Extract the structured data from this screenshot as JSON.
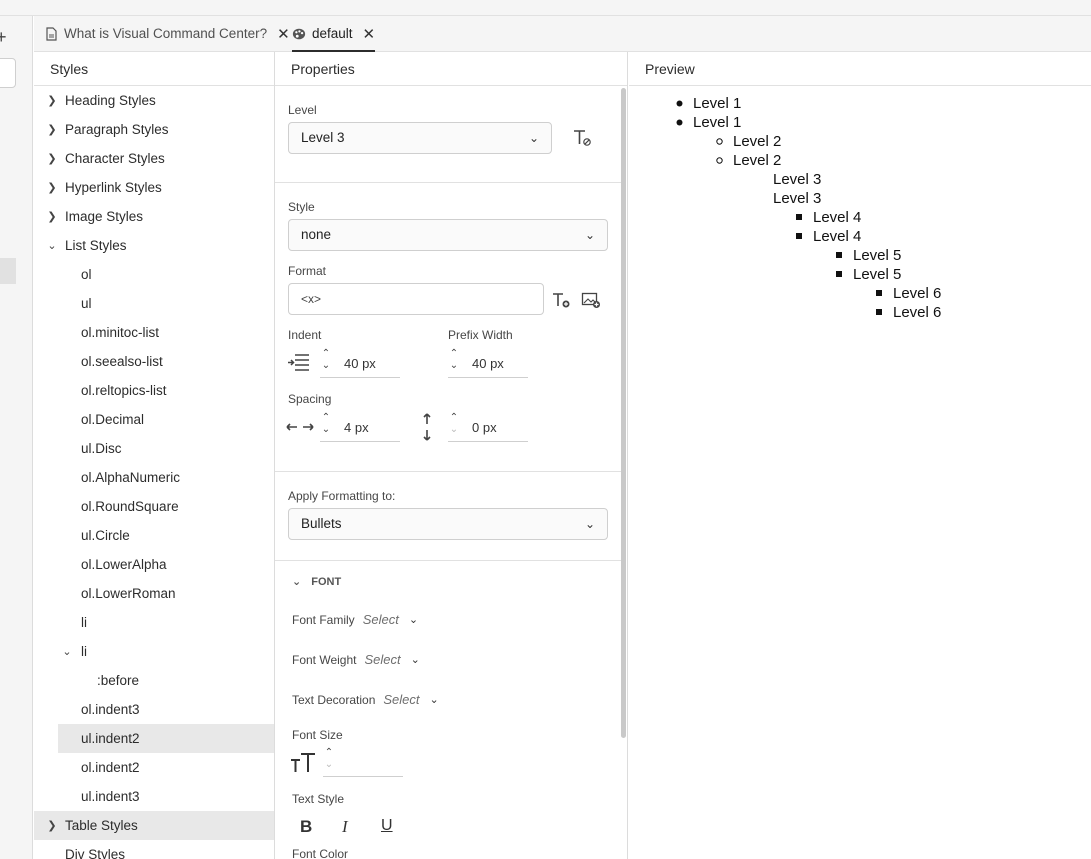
{
  "tabs": [
    {
      "label": "What is Visual Command Center?",
      "icon": "document-icon",
      "active": false
    },
    {
      "label": "default",
      "icon": "palette-icon",
      "active": true
    }
  ],
  "styles_panel": {
    "title": "Styles",
    "groups": [
      {
        "label": "Heading Styles",
        "expanded": false
      },
      {
        "label": "Paragraph Styles",
        "expanded": false
      },
      {
        "label": "Character Styles",
        "expanded": false
      },
      {
        "label": "Hyperlink Styles",
        "expanded": false
      },
      {
        "label": "Image Styles",
        "expanded": false
      },
      {
        "label": "List Styles",
        "expanded": true
      },
      {
        "label": "Table Styles",
        "expanded": false
      },
      {
        "label": "Div Styles",
        "expanded": false
      }
    ],
    "list_items": [
      "ol",
      "ul",
      "ol.minitoc-list",
      "ol.seealso-list",
      "ol.reltopics-list",
      "ol.Decimal",
      "ul.Disc",
      "ol.AlphaNumeric",
      "ol.RoundSquare",
      "ul.Circle",
      "ol.LowerAlpha",
      "ol.LowerRoman",
      "li",
      "li",
      ":before",
      "ol.indent3",
      "ul.indent2",
      "ol.indent2",
      "ul.indent3"
    ]
  },
  "properties_panel": {
    "title": "Properties",
    "level": {
      "label": "Level",
      "value": "Level 3"
    },
    "style": {
      "label": "Style",
      "value": "none"
    },
    "format": {
      "label": "Format",
      "value": "<x>"
    },
    "indent": {
      "label": "Indent",
      "value": "40 px"
    },
    "prefix_width": {
      "label": "Prefix Width",
      "value": "40 px"
    },
    "spacing": {
      "label": "Spacing",
      "horizontal": "4 px",
      "vertical": "0 px"
    },
    "apply_formatting": {
      "label": "Apply Formatting to:",
      "value": "Bullets"
    },
    "font": {
      "section_title": "FONT",
      "family_label": "Font Family",
      "weight_label": "Font Weight",
      "decoration_label": "Text Decoration",
      "select_placeholder": "Select",
      "size_label": "Font Size",
      "text_style_label": "Text Style",
      "bold": "B",
      "italic": "I",
      "underline": "U",
      "color_label": "Font Color"
    }
  },
  "preview_panel": {
    "title": "Preview",
    "items": [
      {
        "text": "Level 1",
        "bullet": "disc"
      },
      {
        "text": "Level 1",
        "bullet": "disc"
      },
      {
        "text": "Level 2",
        "bullet": "circle"
      },
      {
        "text": "Level 2",
        "bullet": "circle"
      },
      {
        "text": "Level 3",
        "bullet": "none"
      },
      {
        "text": "Level 3",
        "bullet": "none"
      },
      {
        "text": "Level 4",
        "bullet": "square"
      },
      {
        "text": "Level 4",
        "bullet": "square"
      },
      {
        "text": "Level 5",
        "bullet": "square"
      },
      {
        "text": "Level 5",
        "bullet": "square"
      },
      {
        "text": "Level 6",
        "bullet": "square"
      },
      {
        "text": "Level 6",
        "bullet": "square"
      }
    ]
  },
  "colors": {
    "selected_row": "#e8e8e8",
    "panel_bg": "#f5f5f5",
    "border": "#dcdcdc"
  }
}
